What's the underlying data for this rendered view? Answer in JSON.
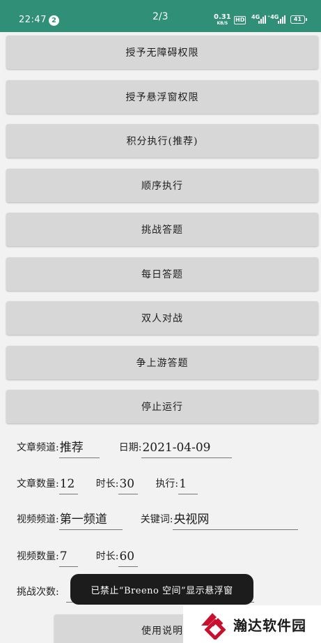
{
  "statusbar": {
    "time": "22:47",
    "notification_count": "2",
    "page_indicator": "2/3",
    "net_speed": "0.31",
    "net_speed_unit": "KB/S",
    "hd_label": "HD",
    "sim1_label": "4G",
    "sim2_label": "⁺4G",
    "battery": "41"
  },
  "buttons": [
    "授予无障碍权限",
    "授予悬浮窗权限",
    "积分执行(推荐)",
    "顺序执行",
    "挑战答题",
    "每日答题",
    "双人对战",
    "争上游答题",
    "停止运行"
  ],
  "form": {
    "article_channel_label": "文章频道:",
    "article_channel_value": "推荐",
    "date_label": "日期:",
    "date_value": "2021-04-09",
    "article_count_label": "文章数量:",
    "article_count_value": "12",
    "duration_label": "时长:",
    "article_duration_value": "30",
    "execute_label": "执行:",
    "execute_value": "1",
    "video_channel_label": "视频频道:",
    "video_channel_value": "第一频道",
    "keyword_label": "关键词:",
    "keyword_value": "央视网",
    "video_count_label": "视频数量:",
    "video_count_value": "7",
    "video_duration_label": "时长:",
    "video_duration_value": "60",
    "challenge_count_label": "挑战次数:"
  },
  "toast": "已禁止“Breeno 空间”显示悬浮窗",
  "bottom_button": "使用说明",
  "watermark": "瀚达软件园",
  "colors": {
    "statusbar": "#2f8f77",
    "button": "#d7d7d7",
    "watermark_logo": "#c8102e"
  }
}
